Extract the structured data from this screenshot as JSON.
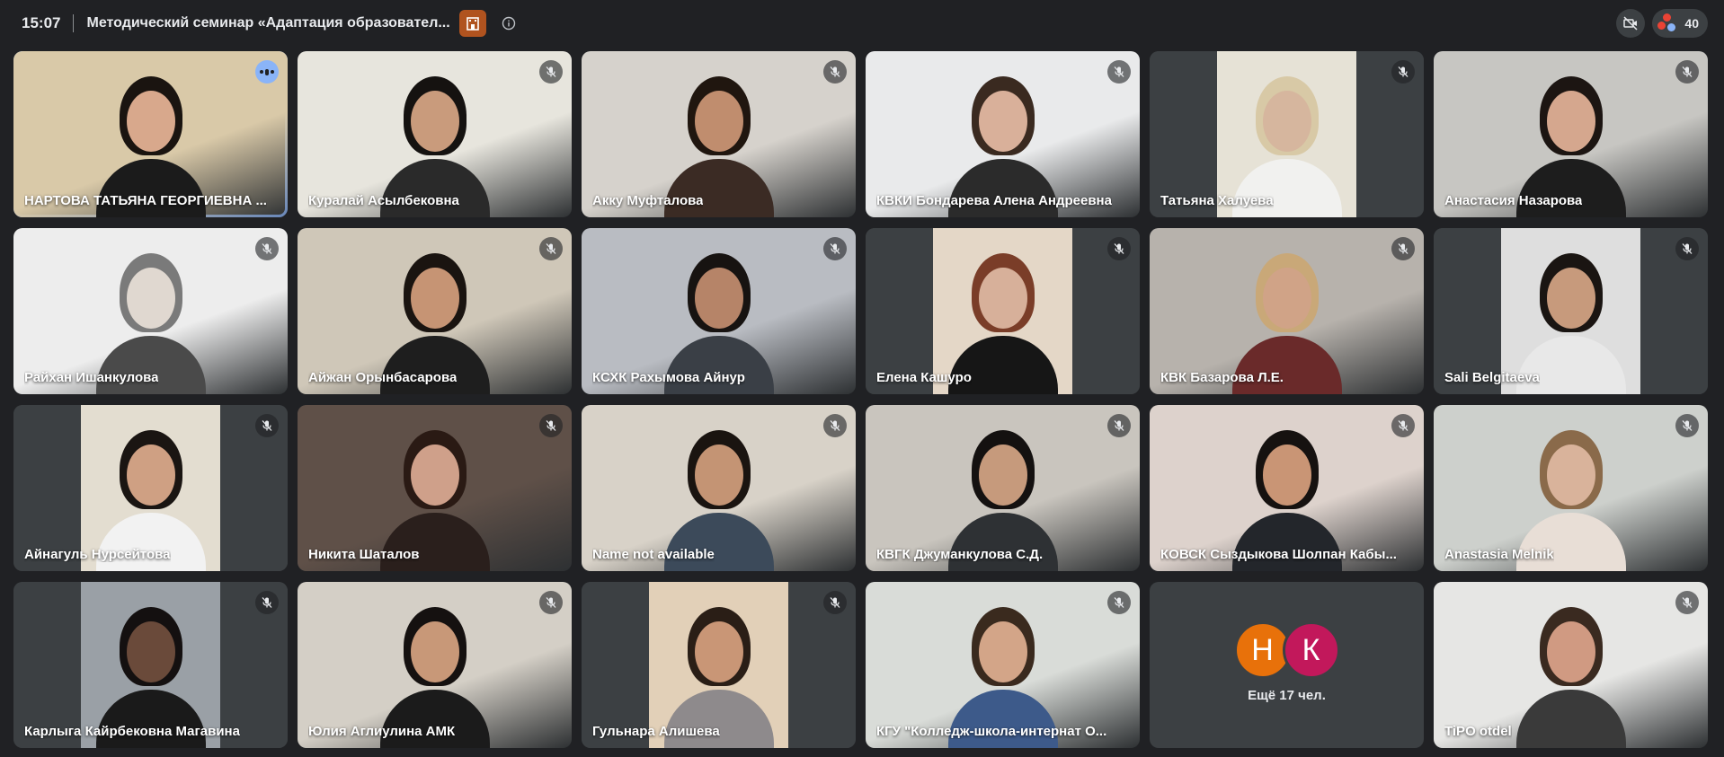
{
  "topbar": {
    "time": "15:07",
    "meeting_title": "Методический семинар «Адаптация образовател...",
    "participants_count": "40"
  },
  "tiles": [
    {
      "name": "НАРТОВА ТАТЬЯНА ГЕОРГИЕВНА ...",
      "speaking": true,
      "bg": "#d9c9a8",
      "shirt": "#1b1b1b",
      "skin": "#d8a88c",
      "hair": "#1a1410"
    },
    {
      "name": "Куралай Асылбековна",
      "bg": "#e7e5dd",
      "shirt": "#2a2a2a",
      "skin": "#c99b7c",
      "hair": "#151210"
    },
    {
      "name": "Акку Муфталова",
      "bg": "#d6d2cc",
      "shirt": "#3b2b24",
      "skin": "#c08d6e",
      "hair": "#20160f"
    },
    {
      "name": "КВКИ Бондарева Алена Андреевна",
      "bg": "#e9eaeb",
      "shirt": "#2b2b2b",
      "skin": "#d9b09a",
      "hair": "#3a2a20"
    },
    {
      "name": "Татьяна Халуева",
      "bg": "#e6e2d6",
      "shirt": "#f1f1ef",
      "skin": "#d6b69e",
      "hair": "#d8c9a6",
      "pillar": true
    },
    {
      "name": "Анастасия Назарова",
      "bg": "#c7c6c2",
      "shirt": "#1d1d1d",
      "skin": "#d5a78e",
      "hair": "#1c1512"
    },
    {
      "name": "Райхан Ишанкулова",
      "bg": "#ededed",
      "shirt": "#4a4a4a",
      "skin": "#e0d8d0",
      "hair": "#7a7a7a"
    },
    {
      "name": "Айжан Орынбасарова",
      "bg": "#cfc7b8",
      "shirt": "#1e1e1e",
      "skin": "#c69474",
      "hair": "#1a1410"
    },
    {
      "name": "КСХК Рахымова Айнур",
      "bg": "#b9bcc2",
      "shirt": "#3a3f46",
      "skin": "#b68468",
      "hair": "#171311"
    },
    {
      "name": "Елена Кашуро",
      "bg": "#e4d7c7",
      "shirt": "#161616",
      "skin": "#d7b09a",
      "hair": "#7a3d28",
      "pillar": true
    },
    {
      "name": "КВК Базарова Л.Е.",
      "bg": "#b7b2ac",
      "shirt": "#6a2a2a",
      "skin": "#d0a387",
      "hair": "#c9a878"
    },
    {
      "name": "Sali Belgitaeva",
      "bg": "#dedede",
      "shirt": "#e8e8e8",
      "skin": "#c79a7c",
      "hair": "#1a1512",
      "pillar": true
    },
    {
      "name": "Айнагуль Нурсейтова",
      "bg": "#e3ddd0",
      "shirt": "#f2f2f2",
      "skin": "#cfa083",
      "hair": "#1a1512",
      "pillar": true
    },
    {
      "name": "Никита Шаталов",
      "bg": "#5f5048",
      "shirt": "#2a1f1c",
      "skin": "#cfa08a",
      "hair": "#2a1a14"
    },
    {
      "name": "Name not available",
      "bg": "#d8d2c8",
      "shirt": "#3c4a5a",
      "skin": "#c49474",
      "hair": "#1a1410"
    },
    {
      "name": "КВГК Джуманкулова С.Д.",
      "bg": "#c9c5be",
      "shirt": "#2e3134",
      "skin": "#c69a7c",
      "hair": "#141110"
    },
    {
      "name": "КОВСК Сыздыкова Шолпан Кабы...",
      "bg": "#ddd2cc",
      "shirt": "#23262b",
      "skin": "#c99575",
      "hair": "#161210"
    },
    {
      "name": "Anastasia Melnik",
      "bg": "#cdd0cc",
      "shirt": "#e8ded6",
      "skin": "#d9b39b",
      "hair": "#8a6a4a"
    },
    {
      "name": "Карлыга Кайрбековна Магавина",
      "bg": "#9aa0a6",
      "shirt": "#1a1a1a",
      "skin": "#6a4a3a",
      "hair": "#141010",
      "pillar": true
    },
    {
      "name": "Юлия Аглиулина АМК",
      "bg": "#d4cfc6",
      "shirt": "#1b1b1b",
      "skin": "#c89878",
      "hair": "#151110"
    },
    {
      "name": "Гульнара Алишева",
      "bg": "#e2d0b8",
      "shirt": "#8e8a8c",
      "skin": "#c99676",
      "hair": "#2a1e16",
      "pillar": true
    },
    {
      "name": "КГУ \"Колледж-школа-интернат О...",
      "bg": "#d9dcd8",
      "shirt": "#3d5a8a",
      "skin": "#d3a588",
      "hair": "#3a2a1e"
    }
  ],
  "more": {
    "avatar1_letter": "Н",
    "avatar1_color": "#e8710a",
    "avatar2_letter": "К",
    "avatar2_color": "#c2185b",
    "label": "Ещё 17 чел."
  },
  "last_tile": {
    "name": "TiPO otdel",
    "bg": "#e6e6e4",
    "shirt": "#3a3a3a",
    "skin": "#d09a82",
    "hair": "#3a2a20"
  },
  "icons": {
    "info": "info-icon",
    "mic_off": "mic-off-icon",
    "speaking": "speaking-indicator-icon",
    "people": "people-icon",
    "camera_off": "camera-off-icon"
  }
}
